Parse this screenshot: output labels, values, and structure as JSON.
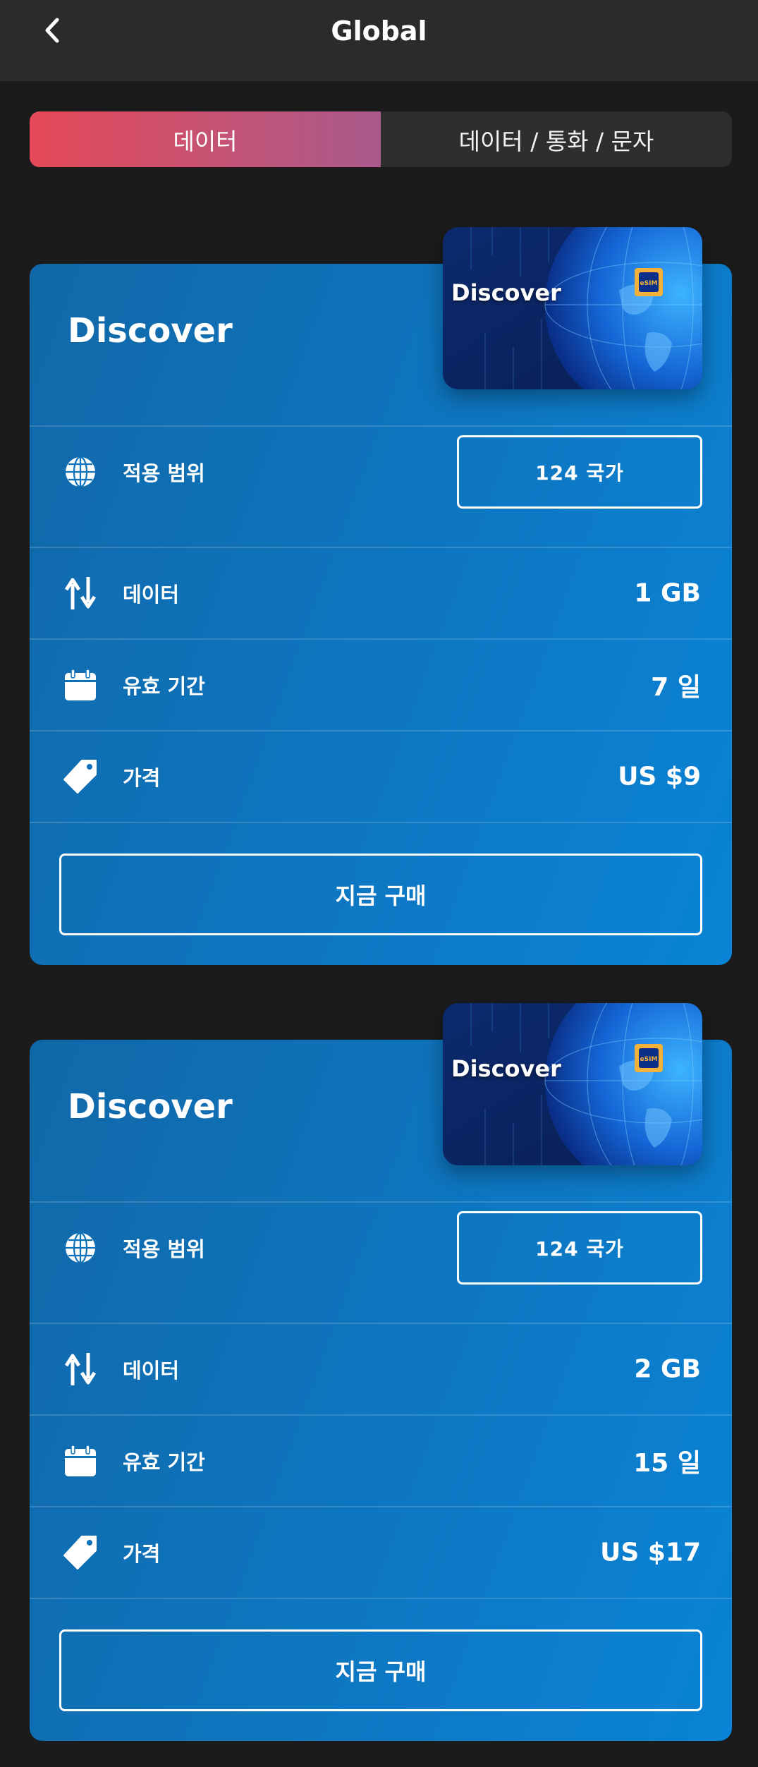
{
  "header": {
    "title": "Global",
    "back_icon": "chevron-left-icon"
  },
  "tabs": [
    {
      "label": "데이터",
      "active": true
    },
    {
      "label": "데이터 / 통화 / 문자",
      "active": false
    }
  ],
  "colors": {
    "background": "#1b1b1b",
    "header": "#2b2b2b",
    "tab_active_start": "#e64a58",
    "tab_active_end": "#a85a8c",
    "card": "#0d78c4"
  },
  "plans": [
    {
      "name": "Discover",
      "thumbnail_label": "Discover",
      "thumbnail_chip": "eSIM",
      "scope": {
        "label": "적용 범위",
        "value": "124 국가",
        "icon": "globe-icon"
      },
      "data": {
        "label": "데이터",
        "value": "1 GB",
        "icon": "up-down-arrows-icon"
      },
      "validity": {
        "label": "유효 기간",
        "value": "7 일",
        "icon": "calendar-icon"
      },
      "price": {
        "label": "가격",
        "value": "US $9",
        "icon": "price-tag-icon"
      },
      "buy_label": "지금 구매"
    },
    {
      "name": "Discover",
      "thumbnail_label": "Discover",
      "thumbnail_chip": "eSIM",
      "scope": {
        "label": "적용 범위",
        "value": "124 국가",
        "icon": "globe-icon"
      },
      "data": {
        "label": "데이터",
        "value": "2 GB",
        "icon": "up-down-arrows-icon"
      },
      "validity": {
        "label": "유효 기간",
        "value": "15 일",
        "icon": "calendar-icon"
      },
      "price": {
        "label": "가격",
        "value": "US $17",
        "icon": "price-tag-icon"
      },
      "buy_label": "지금 구매"
    }
  ]
}
